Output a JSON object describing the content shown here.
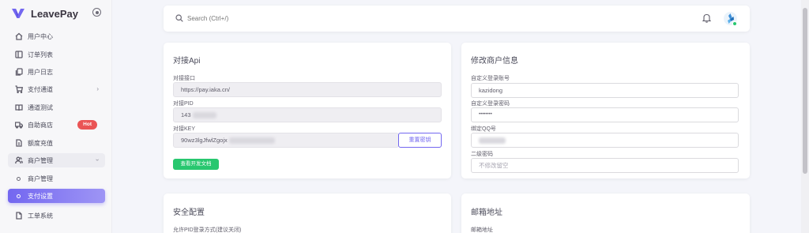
{
  "brand": {
    "name": "LeavePay"
  },
  "sidebar": {
    "items": [
      {
        "label": "用户中心",
        "icon": "home-icon"
      },
      {
        "label": "订单列表",
        "icon": "list-icon"
      },
      {
        "label": "用户日志",
        "icon": "copy-icon"
      },
      {
        "label": "支付通道",
        "icon": "cart-icon"
      },
      {
        "label": "通道测试",
        "icon": "book-icon"
      },
      {
        "label": "自助商店",
        "icon": "truck-icon",
        "badge": "Hot"
      },
      {
        "label": "额度充值",
        "icon": "file-icon"
      },
      {
        "label": "商户管理",
        "icon": "users-icon"
      },
      {
        "label": "商户管理"
      },
      {
        "label": "支付设置"
      },
      {
        "label": "工单系统",
        "icon": "ticket-icon"
      }
    ]
  },
  "topbar": {
    "search_placeholder": "Search (Ctrl+/)"
  },
  "api_card": {
    "title": "对接Api",
    "endpoint_label": "对接接口",
    "endpoint_value": "https://pay.iaka.cn/",
    "pid_label": "对接PID",
    "pid_value": "143",
    "key_label": "对接KEY",
    "key_value": "90wz3lgJfwlZgojx",
    "reset_key_button": "重置密钥",
    "docs_button": "查看开发文档"
  },
  "merchant_card": {
    "title": "修改商户信息",
    "account_label": "自定义登录账号",
    "account_value": "kazidong",
    "password_label": "自定义登录密码",
    "password_value": "••••••••",
    "qq_label": "绑定QQ号",
    "second_pwd_label": "二级密码",
    "second_pwd_placeholder": "不修改留空"
  },
  "security_card": {
    "title": "安全配置",
    "pid_login_label": "允许PID登录方式(建议关闭)"
  },
  "email_card": {
    "title": "邮箱地址",
    "email_label": "邮箱地址"
  },
  "colors": {
    "accent": "#7367f0",
    "success": "#28c76f",
    "danger": "#ea5455"
  }
}
